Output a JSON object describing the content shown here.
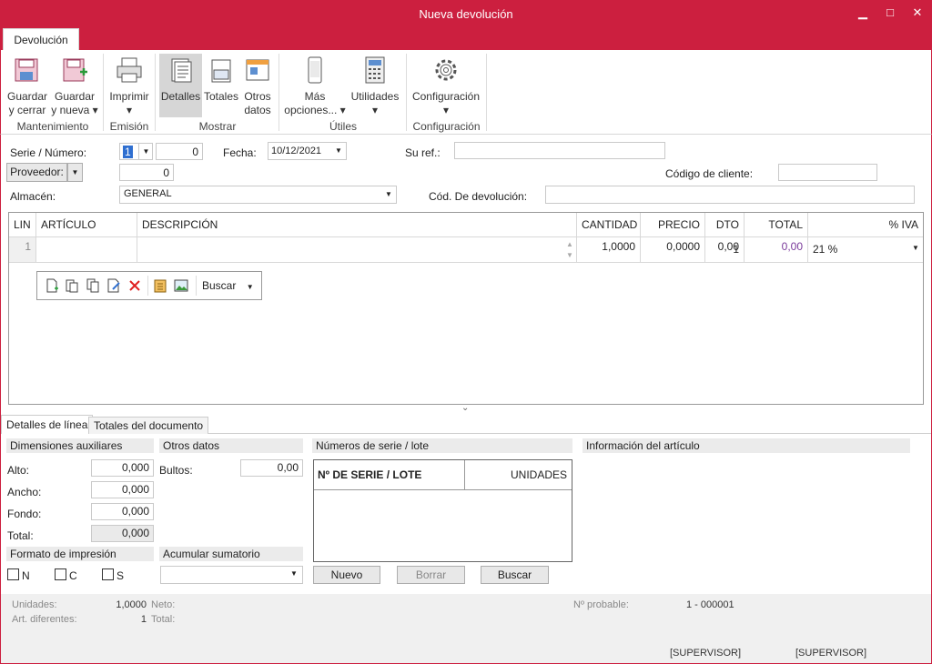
{
  "window": {
    "title": "Nueva devolución",
    "minimize": "▁",
    "maximize": "□",
    "close": "✕"
  },
  "ribbon": {
    "tab": "Devolución",
    "buttons": {
      "guardar_cerrar": [
        "Guardar",
        "y cerrar"
      ],
      "guardar_nueva": [
        "Guardar",
        "y nueva ▾"
      ],
      "imprimir": [
        "Imprimir",
        "▾"
      ],
      "detalles": "Detalles",
      "totales": "Totales",
      "otros_datos": [
        "Otros",
        "datos"
      ],
      "mas_opciones": [
        "Más",
        "opciones... ▾"
      ],
      "utilidades": [
        "Utilidades",
        "▾"
      ],
      "configuracion": [
        "Configuración",
        "▾"
      ]
    },
    "groups": {
      "mantenimiento": "Mantenimiento",
      "emision": "Emisión",
      "mostrar": "Mostrar",
      "utiles": "Útiles",
      "configuracion": "Configuración"
    }
  },
  "header": {
    "serie_label": "Serie / Número:",
    "serie_value": "1",
    "numero_value": "0",
    "fecha_label": "Fecha:",
    "fecha_value": "10/12/2021",
    "su_ref_label": "Su ref.:",
    "su_ref_value": "",
    "proveedor_button": "Proveedor:",
    "proveedor_value": "0",
    "codigo_cliente_label": "Código de cliente:",
    "codigo_cliente_value": "",
    "almacen_label": "Almacén:",
    "almacen_value": "GENERAL",
    "cod_devolucion_label": "Cód. De devolución:",
    "cod_devolucion_value": ""
  },
  "grid": {
    "columns": [
      "LIN",
      "ARTÍCULO",
      "DESCRIPCIÓN",
      "CANTIDAD",
      "PRECIO",
      "DTO 1",
      "TOTAL",
      "% IVA"
    ],
    "rows": [
      {
        "lin": "1",
        "articulo": "",
        "descripcion": "",
        "cantidad": "1,0000",
        "precio": "0,0000",
        "dto1": "0,00",
        "total": "0,00",
        "iva": "21 %"
      }
    ],
    "toolbar_buscar": "Buscar"
  },
  "bottom_tabs": [
    "Detalles de línea",
    "Totales del documento"
  ],
  "dimensiones": {
    "title": "Dimensiones auxiliares",
    "alto_label": "Alto:",
    "alto": "0,000",
    "ancho_label": "Ancho:",
    "ancho": "0,000",
    "fondo_label": "Fondo:",
    "fondo": "0,000",
    "total_label": "Total:",
    "total": "0,000"
  },
  "otros_datos": {
    "title": "Otros datos",
    "bultos_label": "Bultos:",
    "bultos": "0,00"
  },
  "formato": {
    "title": "Formato de impresión",
    "n": "N",
    "c": "C",
    "s": "S"
  },
  "acumular": {
    "title": "Acumular sumatorio",
    "value": ""
  },
  "series": {
    "title": "Números de serie / lote",
    "col1": "Nº DE SERIE / LOTE",
    "col2": "UNIDADES",
    "nuevo": "Nuevo",
    "borrar": "Borrar",
    "buscar": "Buscar"
  },
  "info_articulo": {
    "title": "Información del artículo"
  },
  "footer": {
    "unidades_label": "Unidades:",
    "unidades": "1,0000",
    "art_dif_label": "Art. diferentes:",
    "art_dif": "1",
    "neto_label": "Neto:",
    "total_label": "Total:",
    "n_probable_label": "Nº probable:",
    "n_probable": "1 - 000001",
    "user1": "[SUPERVISOR]",
    "user2": "[SUPERVISOR]"
  }
}
